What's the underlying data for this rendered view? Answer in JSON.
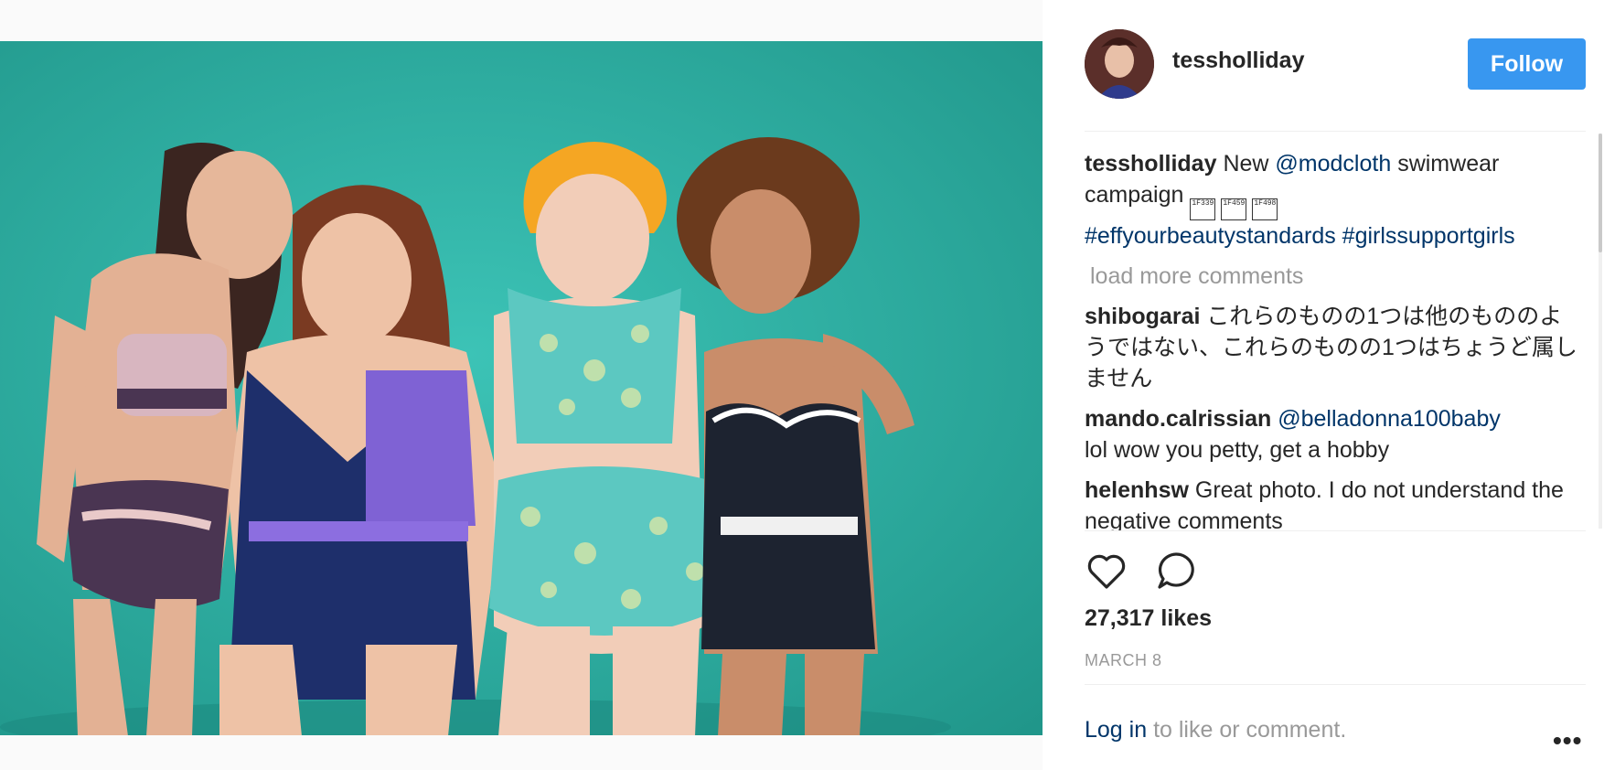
{
  "post": {
    "username": "tessholliday",
    "follow_label": "Follow",
    "caption": {
      "user": "tessholliday",
      "text_before": "New",
      "mention": "@modcloth",
      "text_after": "swimwear campaign",
      "emoji_codes": [
        "1F339",
        "1F459",
        "1F498"
      ],
      "hashtags": "#effyourbeautystandards #girlssupportgirls"
    },
    "load_more_label": "load more comments",
    "comments": [
      {
        "user": "shibogarai",
        "text": "これらのものの1つは他のもののようではない、これらのものの1つはちょうど属しません",
        "mention": ""
      },
      {
        "user": "mando.calrissian",
        "mention": "@belladonna100baby",
        "text": "lol wow you petty, get a hobby"
      },
      {
        "user": "helenhsw",
        "mention": "",
        "text": "Great photo. I do not understand the negative comments"
      }
    ],
    "likes": "27,317 likes",
    "date": "MARCH 8",
    "login_link": "Log in",
    "login_text": "to like or comment.",
    "more_label": "•••"
  },
  "icons": {
    "like": "heart-icon",
    "comment": "comment-bubble-icon",
    "more": "more-options-icon"
  },
  "colors": {
    "follow_button": "#3897f0",
    "link": "#003569",
    "photo_background": "#2aa99e"
  }
}
